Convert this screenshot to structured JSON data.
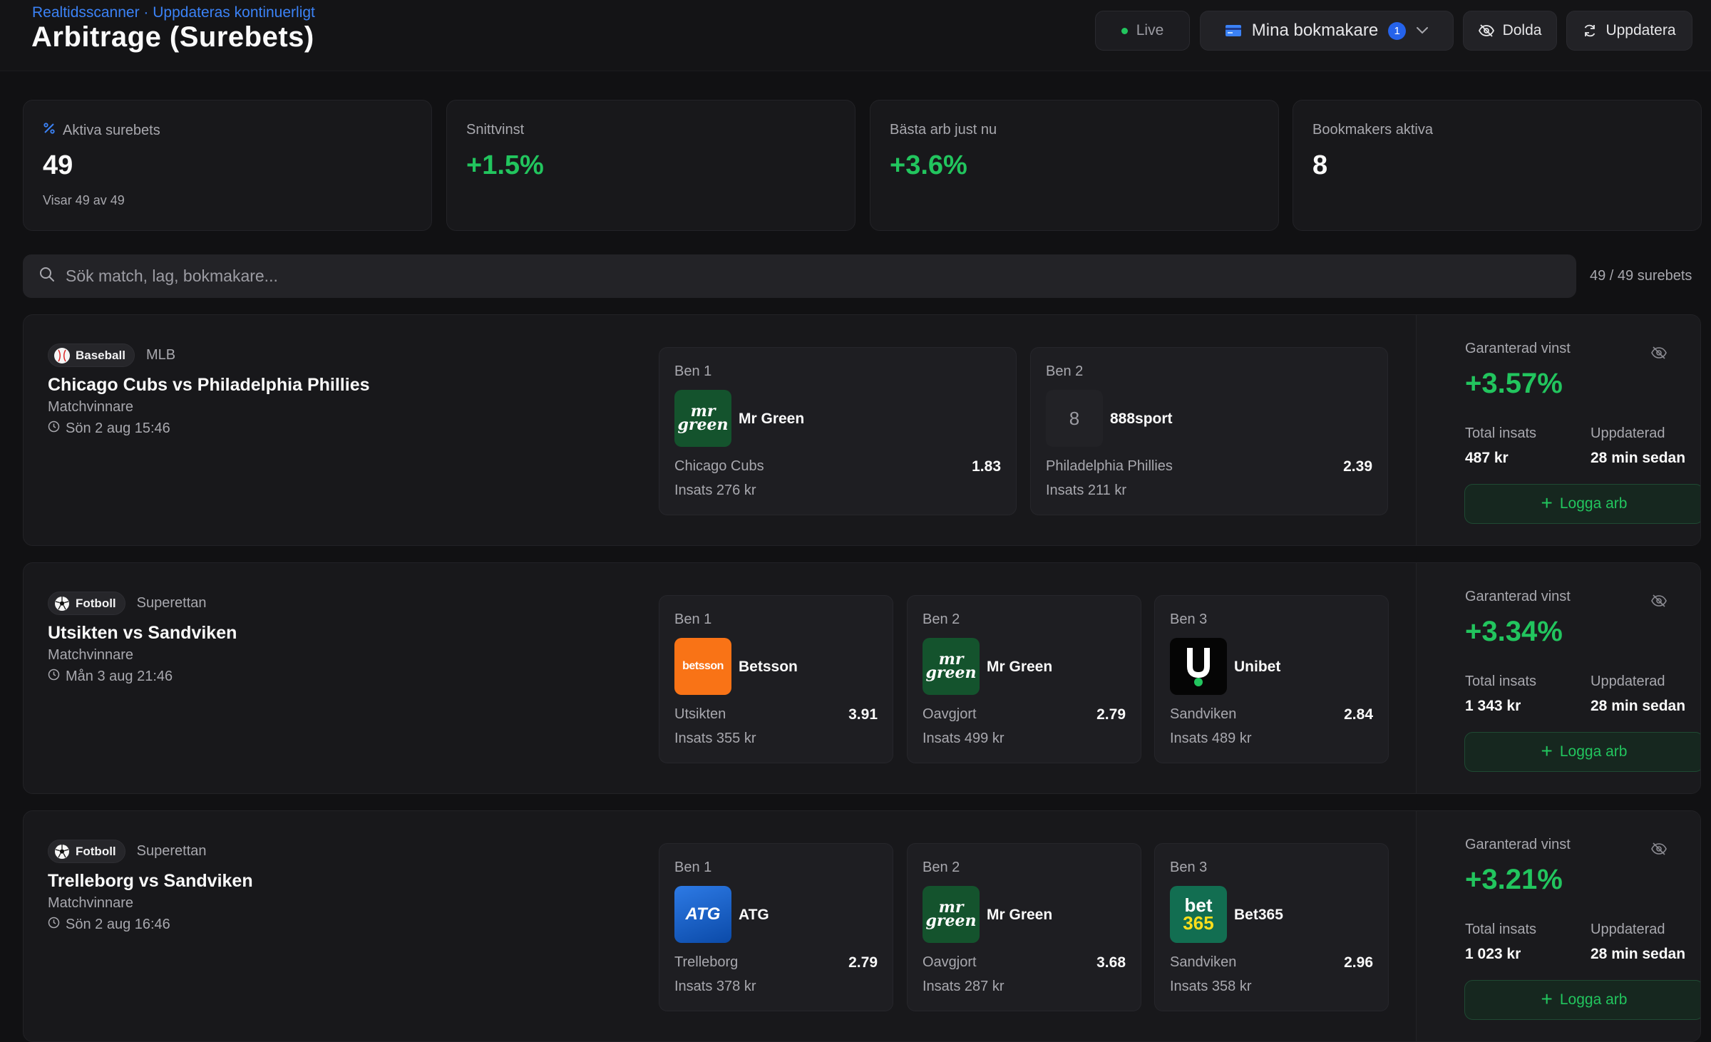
{
  "header": {
    "subtitle": "Realtidsscanner · Uppdateras kontinuerligt",
    "title": "Arbitrage (Surebets)",
    "live_label": "Live",
    "bookmakers_label": "Mina bokmakare",
    "bookmakers_badge": "1",
    "hidden_label": "Dolda",
    "refresh_label": "Uppdatera"
  },
  "stats": [
    {
      "label": "Aktiva surebets",
      "value": "49",
      "sub": "Visar 49 av 49"
    },
    {
      "label": "Snittvinst",
      "value": "+1.5%"
    },
    {
      "label": "Bästa arb just nu",
      "value": "+3.6%"
    },
    {
      "label": "Bookmakers aktiva",
      "value": "8"
    }
  ],
  "search": {
    "placeholder": "Sök match, lag, bokmakare...",
    "result_count": "49 / 49 surebets"
  },
  "labels": {
    "guaranteed": "Garanterad vinst",
    "total_stake": "Total insats",
    "updated": "Uppdaterad",
    "log_button": "Logga arb"
  },
  "colors": {
    "accent_green": "#22c55e",
    "accent_blue": "#3b82f6",
    "background": "#111113"
  },
  "surebets": [
    {
      "sport": "Baseball",
      "league": "MLB",
      "match": "Chicago Cubs vs Philadelphia Phillies",
      "market": "Matchvinnare",
      "kickoff": "Sön 2 aug 15:46",
      "profit": "+3.57%",
      "total_stake": "487 kr",
      "updated": "28 min sedan",
      "legs": [
        {
          "label": "Ben 1",
          "bookmaker": "Mr Green",
          "logo": "mrgreen",
          "logo_text": "mr green",
          "outcome": "Chicago Cubs",
          "odds": "1.83",
          "stake": "Insats 276 kr"
        },
        {
          "label": "Ben 2",
          "bookmaker": "888sport",
          "logo": "888",
          "logo_text": "8",
          "outcome": "Philadelphia Phillies",
          "odds": "2.39",
          "stake": "Insats 211 kr"
        }
      ]
    },
    {
      "sport": "Fotboll",
      "league": "Superettan",
      "match": "Utsikten vs Sandviken",
      "market": "Matchvinnare",
      "kickoff": "Mån 3 aug 21:46",
      "profit": "+3.34%",
      "total_stake": "1 343 kr",
      "updated": "28 min sedan",
      "legs": [
        {
          "label": "Ben 1",
          "bookmaker": "Betsson",
          "logo": "betsson",
          "logo_text": "betsson",
          "outcome": "Utsikten",
          "odds": "3.91",
          "stake": "Insats 355 kr"
        },
        {
          "label": "Ben 2",
          "bookmaker": "Mr Green",
          "logo": "mrgreen",
          "logo_text": "mr green",
          "outcome": "Oavgjort",
          "odds": "2.79",
          "stake": "Insats 499 kr"
        },
        {
          "label": "Ben 3",
          "bookmaker": "Unibet",
          "logo": "unibet",
          "logo_text": "U",
          "outcome": "Sandviken",
          "odds": "2.84",
          "stake": "Insats 489 kr"
        }
      ]
    },
    {
      "sport": "Fotboll",
      "league": "Superettan",
      "match": "Trelleborg vs Sandviken",
      "market": "Matchvinnare",
      "kickoff": "Sön 2 aug 16:46",
      "profit": "+3.21%",
      "total_stake": "1 023 kr",
      "updated": "28 min sedan",
      "legs": [
        {
          "label": "Ben 1",
          "bookmaker": "ATG",
          "logo": "atg",
          "logo_text": "ATG",
          "outcome": "Trelleborg",
          "odds": "2.79",
          "stake": "Insats 378 kr"
        },
        {
          "label": "Ben 2",
          "bookmaker": "Mr Green",
          "logo": "mrgreen",
          "logo_text": "mr green",
          "outcome": "Oavgjort",
          "odds": "3.68",
          "stake": "Insats 287 kr"
        },
        {
          "label": "Ben 3",
          "bookmaker": "Bet365",
          "logo": "bet365",
          "logo_text": "bet 365",
          "outcome": "Sandviken",
          "odds": "2.96",
          "stake": "Insats 358 kr"
        }
      ]
    }
  ]
}
